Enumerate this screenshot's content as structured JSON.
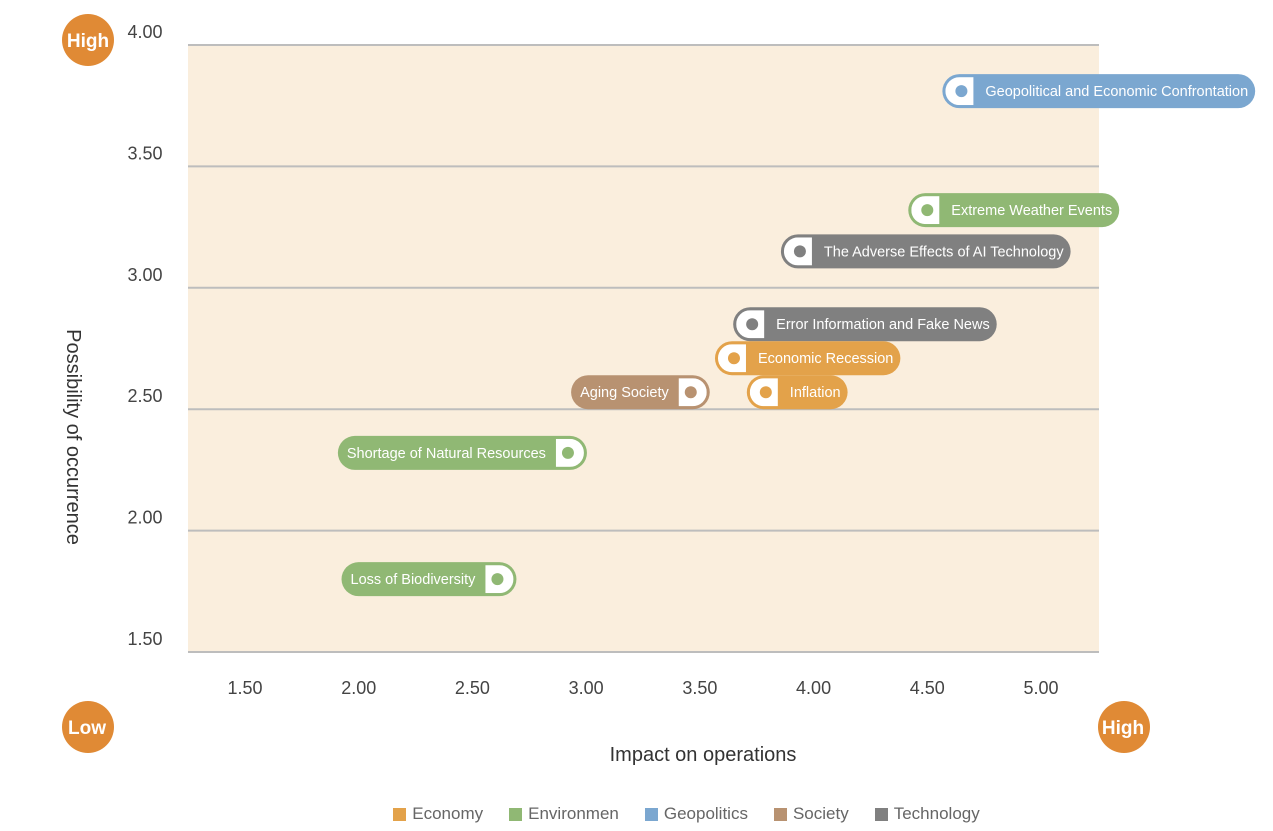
{
  "chart_data": {
    "type": "scatter",
    "title": "",
    "xlabel": "Impact on operations",
    "ylabel": "Possibility of occurrence",
    "xlim": [
      1.25,
      5.25
    ],
    "ylim": [
      1.5,
      4.0
    ],
    "x_ticks": [
      "1.50",
      "2.00",
      "2.50",
      "3.00",
      "3.50",
      "4.00",
      "4.50",
      "5.00"
    ],
    "y_ticks": [
      "4.00",
      "3.50",
      "3.00",
      "2.50",
      "2.00",
      "1.50"
    ],
    "grid": "horizontal",
    "corner_badges": {
      "top_left": "High",
      "bottom_left": "Low",
      "bottom_right": "High"
    },
    "categories": [
      {
        "name": "Economy",
        "color": "#E3A24A"
      },
      {
        "name": "Environmen",
        "color": "#90B874"
      },
      {
        "name": "Geopolitics",
        "color": "#7BA7D0"
      },
      {
        "name": "Society",
        "color": "#B89271"
      },
      {
        "name": "Technology",
        "color": "#808080"
      }
    ],
    "points": [
      {
        "label": "Geopolitical and Economic Confrontation",
        "category": "Geopolitics",
        "x": 4.65,
        "y": 3.81,
        "label_side": "right"
      },
      {
        "label": "Extreme Weather Events",
        "category": "Environmen",
        "x": 4.5,
        "y": 3.32,
        "label_side": "right"
      },
      {
        "label": "The Adverse Effects of AI Technology",
        "category": "Technology",
        "x": 3.94,
        "y": 3.15,
        "label_side": "right"
      },
      {
        "label": "Error Information and Fake News",
        "category": "Technology",
        "x": 3.73,
        "y": 2.85,
        "label_side": "right"
      },
      {
        "label": "Economic Recession",
        "category": "Economy",
        "x": 3.65,
        "y": 2.71,
        "label_side": "right"
      },
      {
        "label": "Inflation",
        "category": "Economy",
        "x": 3.79,
        "y": 2.57,
        "label_side": "right"
      },
      {
        "label": "Aging Society",
        "category": "Society",
        "x": 3.46,
        "y": 2.57,
        "label_side": "left"
      },
      {
        "label": "Shortage of Natural Resources",
        "category": "Environmen",
        "x": 2.92,
        "y": 2.32,
        "label_side": "left"
      },
      {
        "label": "Loss of Biodiversity",
        "category": "Environmen",
        "x": 2.61,
        "y": 1.8,
        "label_side": "left"
      }
    ],
    "legend_position": "bottom"
  }
}
